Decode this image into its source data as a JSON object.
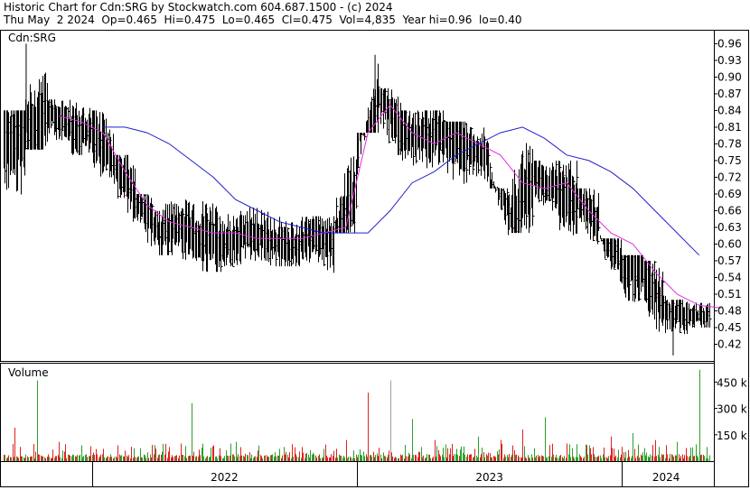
{
  "header": {
    "line1": "Historic Chart for Cdn:SRG by Stockwatch.com 604.687.1500 - (c) 2024",
    "line2": "Thu May  2 2024  Op=0.465  Hi=0.475  Lo=0.465  Cl=0.475  Vol=4,835  Year hi=0.96  lo=0.40"
  },
  "chart_data": [
    {
      "type": "ohlc",
      "title": "Cdn:SRG",
      "ylim": [
        0.39,
        0.985
      ],
      "y_ticks": [
        "0.96",
        "0.93",
        "0.90",
        "0.87",
        "0.84",
        "0.81",
        "0.78",
        "0.75",
        "0.72",
        "0.69",
        "0.66",
        "0.63",
        "0.60",
        "0.57",
        "0.54",
        "0.51",
        "0.48",
        "0.45",
        "0.42"
      ],
      "y_tick_values": [
        0.96,
        0.93,
        0.9,
        0.87,
        0.84,
        0.81,
        0.78,
        0.75,
        0.72,
        0.69,
        0.66,
        0.63,
        0.6,
        0.57,
        0.54,
        0.51,
        0.48,
        0.45,
        0.42
      ],
      "grid": false,
      "x_range": [
        "2021-09",
        "2024-05"
      ],
      "series": [
        {
          "kind": "price",
          "color": "#000000",
          "x": [
            "2021-09",
            "2021-10",
            "2021-11",
            "2021-12",
            "2022-01",
            "2022-02",
            "2022-03",
            "2022-04",
            "2022-05",
            "2022-06",
            "2022-07",
            "2022-08",
            "2022-09",
            "2022-10",
            "2022-11",
            "2022-12",
            "2023-01",
            "2023-02",
            "2023-03",
            "2023-04",
            "2023-05",
            "2023-06",
            "2023-07",
            "2023-08",
            "2023-09",
            "2023-10",
            "2023-11",
            "2023-12",
            "2024-01",
            "2024-02",
            "2024-03",
            "2024-04",
            "2024-05"
          ],
          "high": [
            0.84,
            0.96,
            0.86,
            0.86,
            0.84,
            0.76,
            0.69,
            0.69,
            0.68,
            0.69,
            0.67,
            0.67,
            0.66,
            0.66,
            0.65,
            0.79,
            0.94,
            0.88,
            0.84,
            0.84,
            0.82,
            0.81,
            0.7,
            0.8,
            0.75,
            0.75,
            0.7,
            0.61,
            0.58,
            0.57,
            0.5,
            0.5,
            0.475
          ],
          "low": [
            0.63,
            0.77,
            0.77,
            0.76,
            0.72,
            0.64,
            0.59,
            0.58,
            0.57,
            0.55,
            0.56,
            0.57,
            0.56,
            0.56,
            0.54,
            0.62,
            0.8,
            0.76,
            0.73,
            0.72,
            0.66,
            0.71,
            0.61,
            0.62,
            0.66,
            0.6,
            0.6,
            0.51,
            0.45,
            0.44,
            0.43,
            0.45,
            0.465
          ],
          "close": [
            0.79,
            0.84,
            0.81,
            0.8,
            0.75,
            0.68,
            0.62,
            0.63,
            0.61,
            0.6,
            0.62,
            0.61,
            0.59,
            0.62,
            0.6,
            0.7,
            0.87,
            0.8,
            0.79,
            0.8,
            0.77,
            0.76,
            0.64,
            0.72,
            0.7,
            0.68,
            0.64,
            0.56,
            0.55,
            0.48,
            0.47,
            0.47,
            0.475
          ]
        },
        {
          "kind": "moving_average",
          "color": "#e030e0",
          "x": [
            "2021-11",
            "2021-12",
            "2022-01",
            "2022-02",
            "2022-03",
            "2022-04",
            "2022-05",
            "2022-06",
            "2022-07",
            "2022-08",
            "2022-09",
            "2022-10",
            "2022-11",
            "2022-12",
            "2023-01",
            "2023-02",
            "2023-03",
            "2023-04",
            "2023-05",
            "2023-06",
            "2023-07",
            "2023-08",
            "2023-09",
            "2023-10",
            "2023-11",
            "2023-12",
            "2024-01",
            "2024-02",
            "2024-03",
            "2024-04",
            "2024-05"
          ],
          "values": [
            0.83,
            0.82,
            0.8,
            0.73,
            0.67,
            0.64,
            0.63,
            0.62,
            0.62,
            0.61,
            0.61,
            0.61,
            0.62,
            0.63,
            0.8,
            0.85,
            0.8,
            0.78,
            0.8,
            0.78,
            0.76,
            0.71,
            0.7,
            0.71,
            0.66,
            0.62,
            0.6,
            0.55,
            0.51,
            0.49,
            0.485
          ]
        },
        {
          "kind": "moving_average",
          "color": "#2020d0",
          "x": [
            "2022-01",
            "2022-02",
            "2022-03",
            "2022-04",
            "2022-05",
            "2022-06",
            "2022-07",
            "2022-08",
            "2022-09",
            "2022-10",
            "2022-11",
            "2022-12",
            "2023-01",
            "2023-02",
            "2023-03",
            "2023-04",
            "2023-05",
            "2023-06",
            "2023-07",
            "2023-08",
            "2023-09",
            "2023-10",
            "2023-11",
            "2023-12",
            "2024-01",
            "2024-02",
            "2024-03",
            "2024-04"
          ],
          "values": [
            0.81,
            0.81,
            0.8,
            0.78,
            0.75,
            0.72,
            0.68,
            0.66,
            0.64,
            0.63,
            0.62,
            0.62,
            0.62,
            0.66,
            0.71,
            0.73,
            0.76,
            0.78,
            0.8,
            0.81,
            0.79,
            0.76,
            0.75,
            0.73,
            0.7,
            0.66,
            0.62,
            0.58
          ]
        }
      ]
    },
    {
      "type": "bar",
      "title": "Volume",
      "y_ticks": [
        "450 k",
        "300 k",
        "150 k"
      ],
      "y_tick_values": [
        450000,
        300000,
        150000
      ],
      "ylim": [
        0,
        560000
      ],
      "x_labels": [
        "2022",
        "2023",
        "2024"
      ],
      "colors": {
        "up": "#2aa02a",
        "down": "#e02020",
        "neutral": "#a0a0a0"
      },
      "values_by_month": [
        {
          "month": "2021-09",
          "volume": 190000,
          "dir": "down"
        },
        {
          "month": "2021-10",
          "volume": 460000,
          "dir": "up"
        },
        {
          "month": "2021-11",
          "volume": 110000,
          "dir": "down"
        },
        {
          "month": "2021-12",
          "volume": 90000,
          "dir": "up"
        },
        {
          "month": "2022-01",
          "volume": 70000,
          "dir": "down"
        },
        {
          "month": "2022-02",
          "volume": 60000,
          "dir": "down"
        },
        {
          "month": "2022-03",
          "volume": 50000,
          "dir": "up"
        },
        {
          "month": "2022-04",
          "volume": 80000,
          "dir": "down"
        },
        {
          "month": "2022-05",
          "volume": 330000,
          "dir": "up"
        },
        {
          "month": "2022-06",
          "volume": 90000,
          "dir": "down"
        },
        {
          "month": "2022-07",
          "volume": 110000,
          "dir": "up"
        },
        {
          "month": "2022-08",
          "volume": 60000,
          "dir": "down"
        },
        {
          "month": "2022-09",
          "volume": 70000,
          "dir": "up"
        },
        {
          "month": "2022-10",
          "volume": 80000,
          "dir": "down"
        },
        {
          "month": "2022-11",
          "volume": 70000,
          "dir": "up"
        },
        {
          "month": "2022-12",
          "volume": 120000,
          "dir": "down"
        },
        {
          "month": "2023-01",
          "volume": 390000,
          "dir": "down"
        },
        {
          "month": "2023-02",
          "volume": 460000,
          "dir": "neutral"
        },
        {
          "month": "2023-03",
          "volume": 240000,
          "dir": "up"
        },
        {
          "month": "2023-04",
          "volume": 120000,
          "dir": "down"
        },
        {
          "month": "2023-05",
          "volume": 70000,
          "dir": "up"
        },
        {
          "month": "2023-06",
          "volume": 140000,
          "dir": "up"
        },
        {
          "month": "2023-07",
          "volume": 120000,
          "dir": "down"
        },
        {
          "month": "2023-08",
          "volume": 180000,
          "dir": "down"
        },
        {
          "month": "2023-09",
          "volume": 250000,
          "dir": "up"
        },
        {
          "month": "2023-10",
          "volume": 100000,
          "dir": "down"
        },
        {
          "month": "2023-11",
          "volume": 90000,
          "dir": "up"
        },
        {
          "month": "2023-12",
          "volume": 140000,
          "dir": "down"
        },
        {
          "month": "2024-01",
          "volume": 160000,
          "dir": "up"
        },
        {
          "month": "2024-02",
          "volume": 120000,
          "dir": "down"
        },
        {
          "month": "2024-03",
          "volume": 110000,
          "dir": "up"
        },
        {
          "month": "2024-04",
          "volume": 520000,
          "dir": "up"
        },
        {
          "month": "2024-05",
          "volume": 20000,
          "dir": "up"
        }
      ]
    }
  ]
}
